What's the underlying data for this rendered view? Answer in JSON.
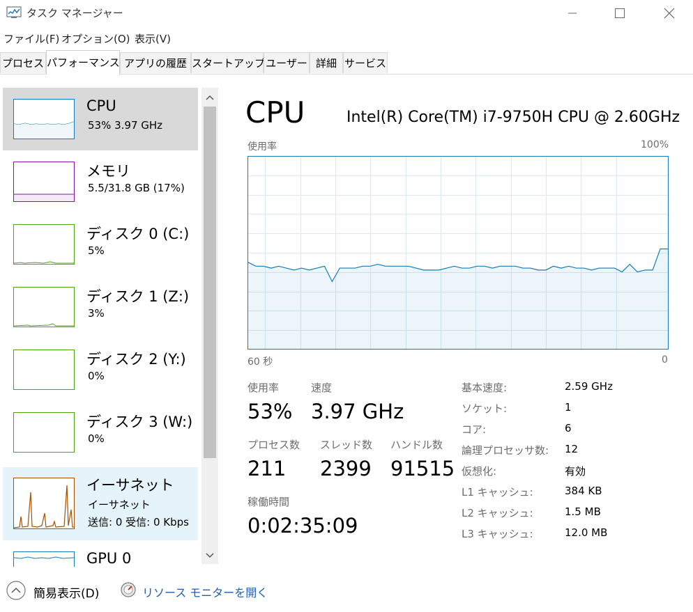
{
  "window": {
    "title": "タスク マネージャー"
  },
  "menu": [
    "ファイル(F)",
    "オプション(O)",
    "表示(V)"
  ],
  "tabs": [
    "プロセス",
    "パフォーマンス",
    "アプリの履歴",
    "スタートアップ",
    "ユーザー",
    "詳細",
    "サービス"
  ],
  "active_tab": "パフォーマンス",
  "sidebar": [
    {
      "title": "CPU",
      "sub": "53%  3.97 GHz",
      "color": "#117dbb"
    },
    {
      "title": "メモリ",
      "sub": "5.5/31.8 GB (17%)",
      "color": "#8b12ae"
    },
    {
      "title": "ディスク 0 (C:)",
      "sub": "5%",
      "color": "#4da60c"
    },
    {
      "title": "ディスク 1 (Z:)",
      "sub": "3%",
      "color": "#4da60c"
    },
    {
      "title": "ディスク 2 (Y:)",
      "sub": "0%",
      "color": "#4da60c"
    },
    {
      "title": "ディスク 3 (W:)",
      "sub": "0%",
      "color": "#4da60c"
    },
    {
      "title": "イーサネット",
      "sub": "イーサネット",
      "sub2": "送信: 0 受信: 0 Kbps",
      "color": "#a74f01"
    },
    {
      "title": "GPU 0",
      "color": "#117dbb"
    }
  ],
  "main": {
    "title": "CPU",
    "model": "Intel(R) Core(TM) i7-9750H CPU @ 2.60GHz",
    "graph_label": "使用率",
    "graph_max": "100%",
    "time_left": "60 秒",
    "time_right": "0",
    "stats": {
      "usage_label": "使用率",
      "usage": "53%",
      "speed_label": "速度",
      "speed": "3.97 GHz",
      "proc_label": "プロセス数",
      "proc": "211",
      "thread_label": "スレッド数",
      "thread": "2399",
      "handle_label": "ハンドル数",
      "handle": "91515",
      "uptime_label": "稼働時間",
      "uptime": "0:02:35:09"
    },
    "specs": [
      {
        "label": "基本速度:",
        "value": "2.59 GHz"
      },
      {
        "label": "ソケット:",
        "value": "1"
      },
      {
        "label": "コア:",
        "value": "6"
      },
      {
        "label": "論理プロセッサ数:",
        "value": "12"
      },
      {
        "label": "仮想化:",
        "value": "有効"
      },
      {
        "label": "L1 キャッシュ:",
        "value": "384 KB"
      },
      {
        "label": "L2 キャッシュ:",
        "value": "1.5 MB"
      },
      {
        "label": "L3 キャッシュ:",
        "value": "12.0 MB"
      }
    ]
  },
  "chart_data": {
    "type": "area",
    "y_unit": "%",
    "ylim": [
      0,
      100
    ],
    "xlabel_left": "60 秒",
    "xlabel_right": "0",
    "series": [
      {
        "values": [
          45,
          43,
          43,
          42,
          43,
          42,
          41,
          42,
          41,
          42,
          43,
          35,
          42,
          42,
          42,
          43,
          43,
          44,
          43,
          43,
          43,
          43,
          42,
          41,
          41,
          41,
          42,
          43,
          42,
          42,
          43,
          43,
          42,
          43,
          43,
          43,
          42,
          42,
          41,
          41,
          43,
          42,
          43,
          42,
          42,
          41,
          42,
          42,
          42,
          40,
          44,
          40,
          41,
          41,
          52,
          52
        ]
      }
    ],
    "color": "#117dbb"
  },
  "footer": {
    "fewer_details": "簡易表示(D)",
    "resource_monitor": "リソース モニターを開く"
  }
}
